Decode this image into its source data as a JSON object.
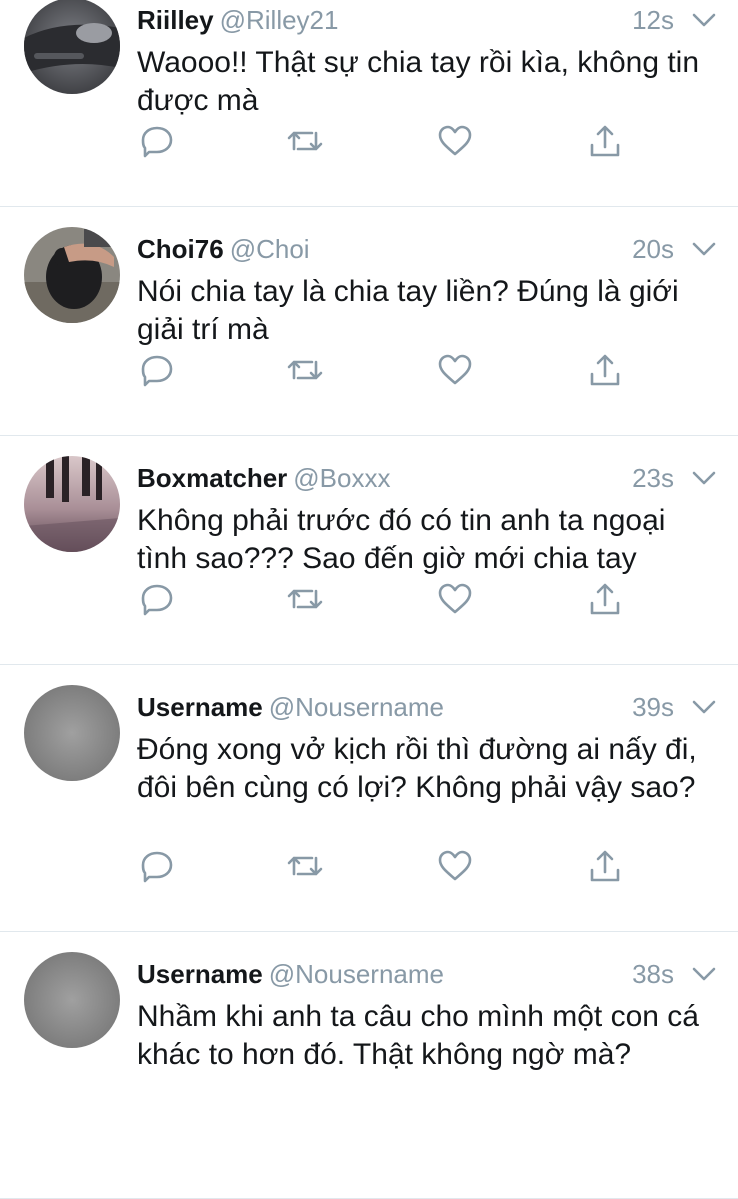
{
  "colors": {
    "name": "#14171a",
    "secondary": "#8899a6",
    "divider": "#e1e8ed",
    "icon": "#8899a6"
  },
  "icons": {
    "reply": "reply-icon",
    "retweet": "retweet-icon",
    "like": "like-icon",
    "share": "share-icon",
    "more": "chevron-down-icon"
  },
  "tweets": [
    {
      "name": "Riilley",
      "handle": "@Rilley21",
      "time": "12s",
      "text": "Waooo!! Thật sự chia tay rồi kìa, không tin được mà",
      "avatar": "car-photo-avatar"
    },
    {
      "name": "Choi76",
      "handle": "@Choi",
      "time": "20s",
      "text": "Nói chia tay là chia tay liền? Đúng là giới giải trí mà",
      "avatar": "cat-photo-avatar"
    },
    {
      "name": "Boxmatcher",
      "handle": "@Boxxx",
      "time": "23s",
      "text": "Không phải trước đó có tin anh ta ngoại tình sao??? Sao đến giờ mới chia tay",
      "avatar": "street-photo-avatar"
    },
    {
      "name": "Username",
      "handle": "@Nousername",
      "time": "39s",
      "text": "Đóng xong vở kịch rồi thì đường ai nấy đi, đôi bên cùng có lợi? Không phải vậy sao?",
      "avatar": "blank-avatar"
    },
    {
      "name": "Username",
      "handle": "@Nousername",
      "time": "38s",
      "text": "Nhầm khi anh ta câu cho mình một con cá khác to hơn đó. Thật không ngờ mà?",
      "avatar": "blank-avatar"
    }
  ]
}
